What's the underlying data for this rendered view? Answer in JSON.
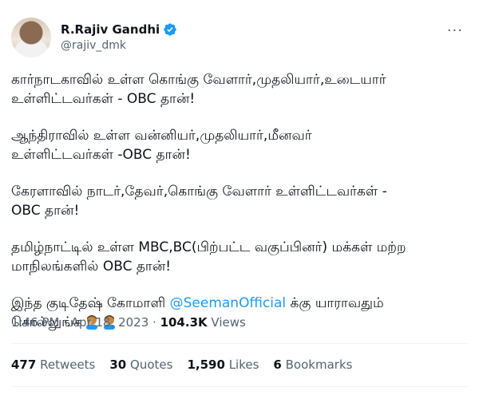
{
  "author": {
    "display_name": "R.Rajiv Gandhi",
    "handle": "@rajiv_dmk"
  },
  "more_icon": "more-horizontal-icon",
  "verified_icon": "verified-badge-icon",
  "colors": {
    "link": "#1d9bf0",
    "secondary_text": "#536471",
    "primary_text": "#0f1419"
  },
  "tweet": {
    "paragraphs": [
      "கார்நாடகாவில் உள்ள கொங்கு வேளார்,முதலியார்,உடையார்\nஉள்ளிட்டவர்கள் - OBC தான்!",
      "ஆந்திராவில் உள்ள வன்னியர்,முதலியார்,மீனவர்\nஉள்ளிட்டவர்கள் -OBC தான்!",
      "கேரளாவில் நாடர்,தேவர்,கொங்கு வேளார் உள்ளிட்டவர்கள் -\nOBC தான்!",
      "தமிழ்நாட்டில் உள்ள MBC,BC(பிற்பட்ட வகுப்பினர்) மக்கள் மற்ற\nமாநிலங்களில் OBC தான்!"
    ],
    "last_prefix": "இந்த குடிதேஷ் கோமாளி ",
    "mention": "@SeemanOfficial",
    "last_suffix": " க்கு யாராவதும்\nசொல்லுங்க",
    "emoji_icons": [
      "man-facepalming-emoji",
      "man-facepalming-emoji"
    ]
  },
  "meta": {
    "time_date": "1:46 PM · Apr 18, 2023 · ",
    "views_count": "104.3K",
    "views_label": " Views"
  },
  "stats": [
    {
      "count": "477",
      "label": "Retweets"
    },
    {
      "count": "30",
      "label": "Quotes"
    },
    {
      "count": "1,590",
      "label": "Likes"
    },
    {
      "count": "6",
      "label": "Bookmarks"
    }
  ]
}
